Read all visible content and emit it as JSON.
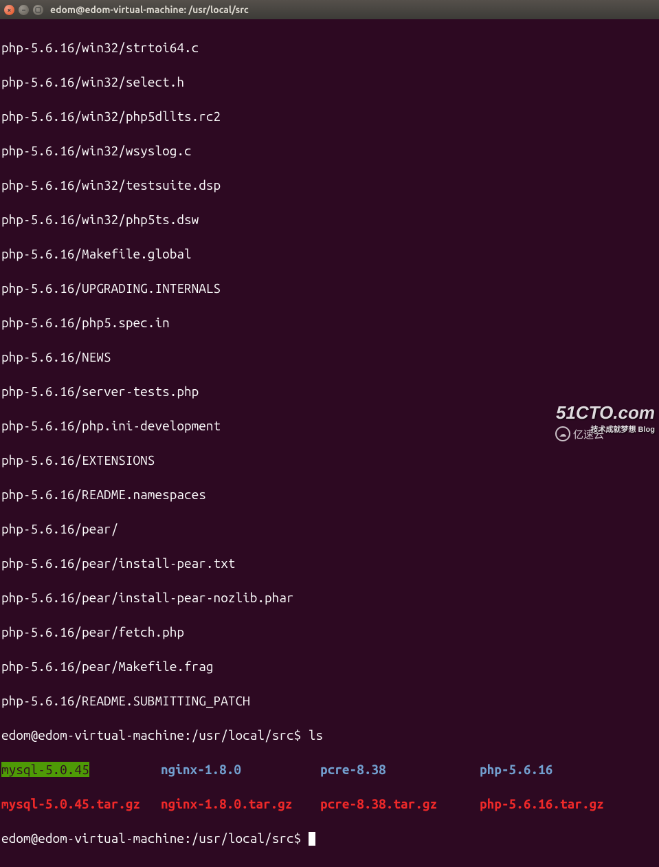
{
  "window": {
    "title": "edom@edom-virtual-machine: /usr/local/src"
  },
  "output_lines": [
    "php-5.6.16/win32/strtoi64.c",
    "php-5.6.16/win32/select.h",
    "php-5.6.16/win32/php5dllts.rc2",
    "php-5.6.16/win32/wsyslog.c",
    "php-5.6.16/win32/testsuite.dsp",
    "php-5.6.16/win32/php5ts.dsw",
    "php-5.6.16/Makefile.global",
    "php-5.6.16/UPGRADING.INTERNALS",
    "php-5.6.16/php5.spec.in",
    "php-5.6.16/NEWS",
    "php-5.6.16/server-tests.php",
    "php-5.6.16/php.ini-development",
    "php-5.6.16/EXTENSIONS",
    "php-5.6.16/README.namespaces",
    "php-5.6.16/pear/",
    "php-5.6.16/pear/install-pear.txt",
    "php-5.6.16/pear/install-pear-nozlib.phar",
    "php-5.6.16/pear/fetch.php",
    "php-5.6.16/pear/Makefile.frag",
    "php-5.6.16/README.SUBMITTING_PATCH"
  ],
  "prompt1": {
    "user_host": "edom@edom-virtual-machine",
    "path": ":/usr/local/src$",
    "cmd": " ls"
  },
  "ls": {
    "row1": {
      "c1": "mysql-5.0.45",
      "c2": "nginx-1.8.0",
      "c3": "pcre-8.38",
      "c4": "php-5.6.16"
    },
    "row2": {
      "c1": "mysql-5.0.45.tar.gz",
      "c2": "nginx-1.8.0.tar.gz",
      "c3": "pcre-8.38.tar.gz",
      "c4": "php-5.6.16.tar.gz"
    }
  },
  "prompt2": {
    "user_host": "edom@edom-virtual-machine",
    "path": ":/usr/local/src$",
    "cmd": " "
  },
  "watermark": {
    "w1": "51CTO.com",
    "w1sub": "技术成就梦想 Blog",
    "w2": "亿速云"
  }
}
